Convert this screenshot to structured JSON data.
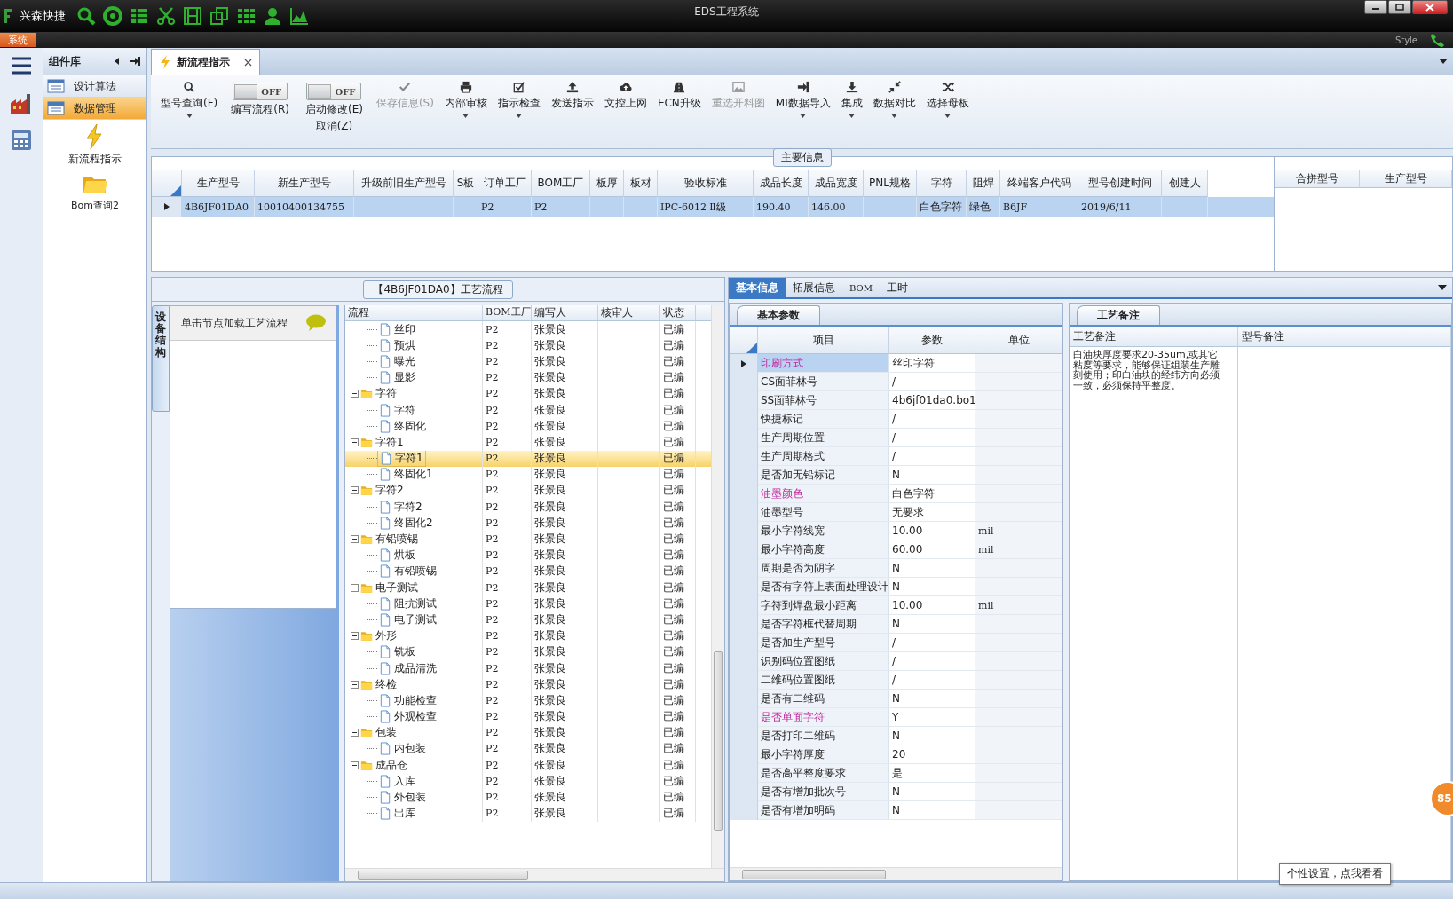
{
  "title_bar": {
    "app_name": "兴森快捷",
    "title": "EDS工程系统"
  },
  "menu_bar": {
    "tab": "系统",
    "style_label": "Style"
  },
  "component_panel": {
    "title": "组件库",
    "items": [
      {
        "label": "设计算法",
        "selected": false
      },
      {
        "label": "数据管理",
        "selected": true
      }
    ],
    "shortcuts": [
      {
        "label": "新流程指示"
      },
      {
        "label": "Bom查询2"
      }
    ]
  },
  "document_tabs": [
    {
      "label": "新流程指示",
      "selected": true
    }
  ],
  "toolbar": [
    {
      "kind": "button",
      "label": "型号查询(F)",
      "dropdown": true,
      "disabled": false
    },
    {
      "kind": "toggle",
      "label": "编写流程(R)",
      "state": "OFF",
      "on": false
    },
    {
      "kind": "toggle",
      "label": "启动修改(E)",
      "sublabel": "取消(Z)",
      "state": "OFF",
      "on": false
    },
    {
      "kind": "button",
      "label": "保存信息(S)",
      "dropdown": false,
      "disabled": true
    },
    {
      "kind": "button",
      "label": "内部审核",
      "dropdown": true,
      "disabled": false
    },
    {
      "kind": "button",
      "label": "指示检查",
      "dropdown": true,
      "disabled": false
    },
    {
      "kind": "button",
      "label": "发送指示",
      "dropdown": false,
      "disabled": false
    },
    {
      "kind": "button",
      "label": "文控上网",
      "dropdown": false,
      "disabled": false
    },
    {
      "kind": "button",
      "label": "ECN升级",
      "dropdown": false,
      "disabled": false
    },
    {
      "kind": "button",
      "label": "重选开料图",
      "dropdown": false,
      "disabled": true
    },
    {
      "kind": "button",
      "label": "MI数据导入",
      "dropdown": true,
      "disabled": false
    },
    {
      "kind": "button",
      "label": "集成",
      "dropdown": true,
      "disabled": false
    },
    {
      "kind": "button",
      "label": "数据对比",
      "dropdown": true,
      "disabled": false
    },
    {
      "kind": "button",
      "label": "选择母板",
      "dropdown": true,
      "disabled": false
    }
  ],
  "main_info": {
    "title": "主要信息",
    "columns": [
      "生产型号",
      "新生产型号",
      "升级前旧生产型号",
      "S板",
      "订单工厂",
      "BOM工厂",
      "板厚",
      "板材",
      "验收标准",
      "成品长度",
      "成品宽度",
      "PNL规格",
      "字符",
      "阻焊",
      "终端客户代码",
      "型号创建时间",
      "创建人"
    ],
    "rows": [
      {
        "selected": true,
        "cells": [
          "4B6JF01DA0",
          "10010400134755",
          null,
          null,
          "P2",
          "P2",
          null,
          null,
          "IPC-6012 Ⅱ级",
          "190.40",
          "146.00",
          null,
          "白色字符",
          "绿色",
          "B6JF",
          "2019/6/11",
          null
        ]
      }
    ],
    "side_columns": [
      "合拼型号",
      "生产型号"
    ]
  },
  "process_panel": {
    "title": "【4B6JF01DA0】工艺流程",
    "side_tab": "设备结构",
    "hint": "单击节点加载工艺流程",
    "columns": [
      "流程",
      "BOM工厂",
      "编写人",
      "核审人",
      "状态"
    ],
    "tree": [
      {
        "children": [
          {
            "label": "丝印",
            "bom": "P2",
            "writer": "张景良",
            "status": "已编",
            "selected": false
          },
          {
            "label": "预烘",
            "bom": "P2",
            "writer": "张景良",
            "status": "已编",
            "selected": false
          },
          {
            "label": "曝光",
            "bom": "P2",
            "writer": "张景良",
            "status": "已编",
            "selected": false
          },
          {
            "label": "显影",
            "bom": "P2",
            "writer": "张景良",
            "status": "已编",
            "selected": false
          }
        ]
      },
      {
        "label": "字符",
        "bom": "P2",
        "writer": "张景良",
        "status": "已编",
        "selected": false,
        "expanded": true,
        "children": [
          {
            "label": "字符",
            "bom": "P2",
            "writer": "张景良",
            "status": "已编",
            "selected": false
          },
          {
            "label": "终固化",
            "bom": "P2",
            "writer": "张景良",
            "status": "已编",
            "selected": false
          }
        ]
      },
      {
        "label": "字符1",
        "bom": "P2",
        "writer": "张景良",
        "status": "已编",
        "selected": false,
        "expanded": true,
        "children": [
          {
            "label": "字符1",
            "bom": "P2",
            "writer": "张景良",
            "status": "已编",
            "selected": true
          },
          {
            "label": "终固化1",
            "bom": "P2",
            "writer": "张景良",
            "status": "已编",
            "selected": false
          }
        ]
      },
      {
        "label": "字符2",
        "bom": "P2",
        "writer": "张景良",
        "status": "已编",
        "selected": false,
        "expanded": true,
        "children": [
          {
            "label": "字符2",
            "bom": "P2",
            "writer": "张景良",
            "status": "已编",
            "selected": false
          },
          {
            "label": "终固化2",
            "bom": "P2",
            "writer": "张景良",
            "status": "已编",
            "selected": false
          }
        ]
      },
      {
        "label": "有铅喷锡",
        "bom": "P2",
        "writer": "张景良",
        "status": "已编",
        "selected": false,
        "expanded": true,
        "children": [
          {
            "label": "烘板",
            "bom": "P2",
            "writer": "张景良",
            "status": "已编",
            "selected": false
          },
          {
            "label": "有铅喷锡",
            "bom": "P2",
            "writer": "张景良",
            "status": "已编",
            "selected": false
          }
        ]
      },
      {
        "label": "电子测试",
        "bom": "P2",
        "writer": "张景良",
        "status": "已编",
        "selected": false,
        "expanded": true,
        "children": [
          {
            "label": "阻抗测试",
            "bom": "P2",
            "writer": "张景良",
            "status": "已编",
            "selected": false
          },
          {
            "label": "电子测试",
            "bom": "P2",
            "writer": "张景良",
            "status": "已编",
            "selected": false
          }
        ]
      },
      {
        "label": "外形",
        "bom": "P2",
        "writer": "张景良",
        "status": "已编",
        "selected": false,
        "expanded": true,
        "children": [
          {
            "label": "铣板",
            "bom": "P2",
            "writer": "张景良",
            "status": "已编",
            "selected": false
          },
          {
            "label": "成品清洗",
            "bom": "P2",
            "writer": "张景良",
            "status": "已编",
            "selected": false
          }
        ]
      },
      {
        "label": "终检",
        "bom": "P2",
        "writer": "张景良",
        "status": "已编",
        "selected": false,
        "expanded": true,
        "children": [
          {
            "label": "功能检查",
            "bom": "P2",
            "writer": "张景良",
            "status": "已编",
            "selected": false
          },
          {
            "label": "外观检查",
            "bom": "P2",
            "writer": "张景良",
            "status": "已编",
            "selected": false
          }
        ]
      },
      {
        "label": "包装",
        "bom": "P2",
        "writer": "张景良",
        "status": "已编",
        "selected": false,
        "expanded": true,
        "children": [
          {
            "label": "内包装",
            "bom": "P2",
            "writer": "张景良",
            "status": "已编",
            "selected": false
          }
        ]
      },
      {
        "label": "成品仓",
        "bom": "P2",
        "writer": "张景良",
        "status": "已编",
        "selected": false,
        "expanded": true,
        "children": [
          {
            "label": "入库",
            "bom": "P2",
            "writer": "张景良",
            "status": "已编",
            "selected": false
          },
          {
            "label": "外包装",
            "bom": "P2",
            "writer": "张景良",
            "status": "已编",
            "selected": false
          },
          {
            "label": "出库",
            "bom": "P2",
            "writer": "张景良",
            "status": "已编",
            "selected": false
          }
        ]
      }
    ]
  },
  "detail_tabs": [
    {
      "label": "基本信息",
      "selected": true
    },
    {
      "label": "拓展信息",
      "selected": false
    },
    {
      "label": "BOM",
      "selected": false
    },
    {
      "label": "工时",
      "selected": false
    }
  ],
  "params": {
    "title": "基本参数",
    "columns": [
      "项目",
      "参数",
      "单位"
    ],
    "rows": [
      {
        "name": "印刷方式",
        "value": "丝印字符",
        "highlighted": true,
        "selected": true
      },
      {
        "name": "CS面菲林号",
        "value": "/",
        "highlighted": false,
        "selected": false
      },
      {
        "name": "SS面菲林号",
        "value": "4b6jf01da0.bo1",
        "highlighted": false,
        "selected": false
      },
      {
        "name": "快捷标记",
        "value": "/",
        "highlighted": false,
        "selected": false
      },
      {
        "name": "生产周期位置",
        "value": "/",
        "highlighted": false,
        "selected": false
      },
      {
        "name": "生产周期格式",
        "value": "/",
        "highlighted": false,
        "selected": false
      },
      {
        "name": "是否加无铅标记",
        "value": "N",
        "highlighted": false,
        "selected": false
      },
      {
        "name": "油墨颜色",
        "value": "白色字符",
        "highlighted": true,
        "selected": false
      },
      {
        "name": "油墨型号",
        "value": "无要求",
        "highlighted": false,
        "selected": false
      },
      {
        "name": "最小字符线宽",
        "value": "10.00",
        "unit": "mil",
        "highlighted": false,
        "selected": false
      },
      {
        "name": "最小字符高度",
        "value": "60.00",
        "unit": "mil",
        "highlighted": false,
        "selected": false
      },
      {
        "name": "周期是否为阴字",
        "value": "N",
        "highlighted": false,
        "selected": false
      },
      {
        "name": "是否有字符上表面处理设计",
        "value": "N",
        "highlighted": false,
        "selected": false
      },
      {
        "name": "字符到焊盘最小距离",
        "value": "10.00",
        "unit": "mil",
        "highlighted": false,
        "selected": false
      },
      {
        "name": "是否字符框代替周期",
        "value": "N",
        "highlighted": false,
        "selected": false
      },
      {
        "name": "是否加生产型号",
        "value": "/",
        "highlighted": false,
        "selected": false
      },
      {
        "name": "识别码位置图纸",
        "value": "/",
        "highlighted": false,
        "selected": false
      },
      {
        "name": "二维码位置图纸",
        "value": "/",
        "highlighted": false,
        "selected": false
      },
      {
        "name": "是否有二维码",
        "value": "N",
        "highlighted": false,
        "selected": false
      },
      {
        "name": "是否单面字符",
        "value": "Y",
        "highlighted": true,
        "selected": false
      },
      {
        "name": "是否打印二维码",
        "value": "N",
        "highlighted": false,
        "selected": false
      },
      {
        "name": "最小字符厚度",
        "value": "20",
        "highlighted": false,
        "selected": false
      },
      {
        "name": "是否高平整度要求",
        "value": "是",
        "highlighted": false,
        "selected": false
      },
      {
        "name": "是否有增加批次号",
        "value": "N",
        "highlighted": false,
        "selected": false
      },
      {
        "name": "是否有增加明码",
        "value": "N",
        "highlighted": false,
        "selected": false
      }
    ]
  },
  "notes": {
    "title": "工艺备注",
    "columns": [
      "工艺备注",
      "型号备注"
    ],
    "process_note": "白油块厚度要求20-35um,或其它粘度等要求，能够保证组装生产雕刻使用；印白油块的经纬方向必须一致，必须保持平整度。"
  },
  "tooltip": "个性设置，点我看看",
  "badge": "85"
}
